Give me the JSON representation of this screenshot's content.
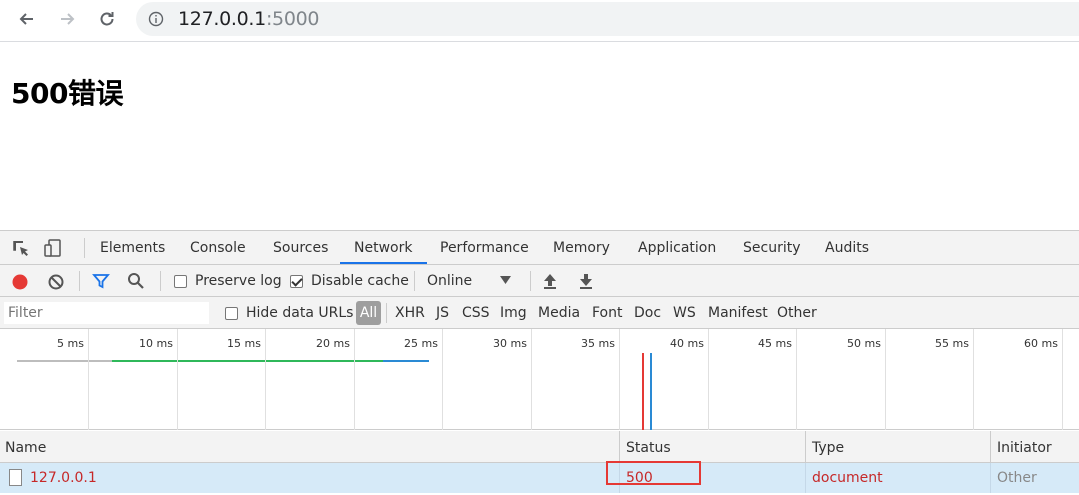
{
  "browser": {
    "url_host": "127.0.0.1",
    "url_port": ":5000"
  },
  "page": {
    "heading": "500错误"
  },
  "devtools": {
    "tabs": [
      "Elements",
      "Console",
      "Sources",
      "Network",
      "Performance",
      "Memory",
      "Application",
      "Security",
      "Audits"
    ],
    "active_tab": "Network",
    "toolbar": {
      "preserve_log": "Preserve log",
      "disable_cache": "Disable cache",
      "throttle": "Online"
    },
    "filter": {
      "placeholder": "Filter",
      "hide_data_urls": "Hide data URLs",
      "types": [
        "All",
        "XHR",
        "JS",
        "CSS",
        "Img",
        "Media",
        "Font",
        "Doc",
        "WS",
        "Manifest",
        "Other"
      ]
    },
    "timeline": {
      "ticks": [
        "5 ms",
        "10 ms",
        "15 ms",
        "20 ms",
        "25 ms",
        "30 ms",
        "35 ms",
        "40 ms",
        "45 ms",
        "50 ms",
        "55 ms",
        "60 ms"
      ]
    },
    "columns": {
      "name": "Name",
      "status": "Status",
      "type": "Type",
      "initiator": "Initiator"
    },
    "rows": [
      {
        "name": "127.0.0.1",
        "status": "500",
        "type": "document",
        "initiator": "Other"
      }
    ]
  },
  "colors": {
    "error_text": "#c62828",
    "accent": "#1a73e8",
    "record_red": "#e53935",
    "highlight_red": "#e53935"
  }
}
